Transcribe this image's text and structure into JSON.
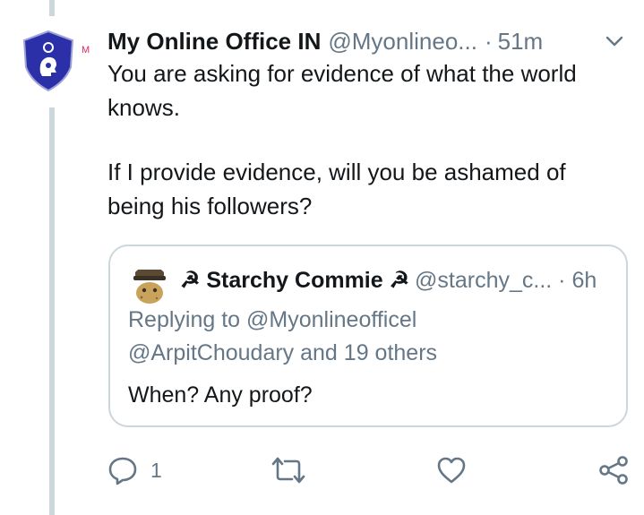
{
  "tweet": {
    "author_name": "My Online Office IN",
    "author_handle": "@Myonlineo...",
    "separator": "·",
    "time": "51m",
    "badge_letter": "M",
    "paragraphs": [
      "You are asking for evidence of what the world knows.",
      "If I provide evidence, will you be ashamed of being his followers?"
    ]
  },
  "quoted": {
    "author_name": "☭ Starchy Commie ☭",
    "author_handle": "@starchy_c...",
    "time": "· 6h",
    "replying_line1": "Replying to @Myonlineofficel",
    "replying_line2": "@ArpitChoudary and 19 others",
    "text": "When? Any proof?"
  },
  "actions": {
    "reply_count": "1",
    "icons": [
      "reply-icon",
      "retweet-icon",
      "like-icon",
      "share-icon"
    ]
  },
  "colors": {
    "text_primary": "#14171a",
    "text_secondary": "#657786",
    "border": "#ccd6dd",
    "avatar_blue": "#2b2fa8"
  }
}
